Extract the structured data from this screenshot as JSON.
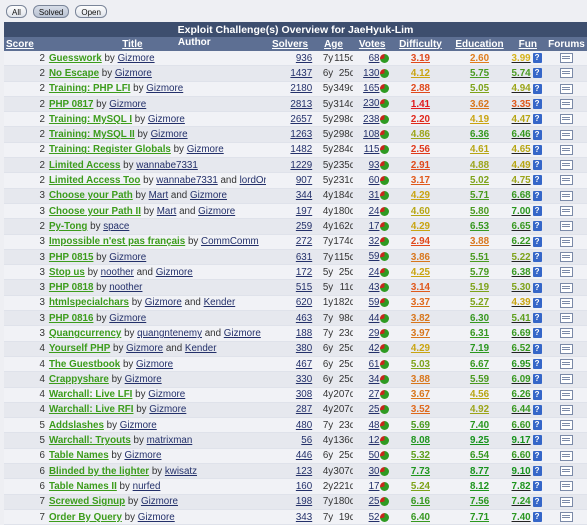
{
  "filters": [
    "All",
    "Solved",
    "Open"
  ],
  "active_filter": "Solved",
  "table_title": "Exploit Challenge(s) Overview for JaeHyuk-Lim",
  "headers": {
    "score": "Score",
    "title": "Title",
    "author": "Author",
    "solvers": "Solvers",
    "age": "Age",
    "votes": "Votes",
    "difficulty": "Difficulty",
    "education": "Education",
    "fun": "Fun",
    "forums": "Forums"
  },
  "rows": [
    {
      "score": "2",
      "title": "Guesswork",
      "authors": [
        "Gizmore"
      ],
      "solvers": "936",
      "age1": "7y",
      "age2": "115d",
      "votes": "68",
      "difficulty": "3.19",
      "education": "2.60",
      "fun": "3.99",
      "dc": "#e0491c",
      "ec": "#e07d1c",
      "fc": "#d6b31a"
    },
    {
      "score": "2",
      "title": "No Escape",
      "authors": [
        "Gizmore"
      ],
      "solvers": "1437",
      "age1": "6y",
      "age2": "25d",
      "votes": "130",
      "difficulty": "4.12",
      "education": "5.75",
      "fun": "5.74",
      "dc": "#c9a411",
      "ec": "#4a9a20",
      "fc": "#4a9a20"
    },
    {
      "score": "2",
      "title": "Training: PHP LFI",
      "authors": [
        "Gizmore"
      ],
      "solvers": "2180",
      "age1": "5y",
      "age2": "349d",
      "votes": "165",
      "difficulty": "2.88",
      "education": "5.05",
      "fun": "4.94",
      "dc": "#e0491c",
      "ec": "#7ea31a",
      "fc": "#9ca51a"
    },
    {
      "score": "2",
      "title": "PHP 0817",
      "authors": [
        "Gizmore"
      ],
      "solvers": "2813",
      "age1": "5y",
      "age2": "314d",
      "votes": "230",
      "difficulty": "1.41",
      "education": "3.62",
      "fun": "3.35",
      "dc": "#e0181c",
      "ec": "#d8761c",
      "fc": "#df591c"
    },
    {
      "score": "2",
      "title": "Training: MySQL I",
      "authors": [
        "Gizmore"
      ],
      "solvers": "2657",
      "age1": "5y",
      "age2": "298d",
      "votes": "238",
      "difficulty": "2.20",
      "education": "4.19",
      "fun": "4.47",
      "dc": "#e0281c",
      "ec": "#c9a411",
      "fc": "#b7a614"
    },
    {
      "score": "2",
      "title": "Training: MySQL II",
      "authors": [
        "Gizmore"
      ],
      "solvers": "1263",
      "age1": "5y",
      "age2": "298d",
      "votes": "108",
      "difficulty": "4.86",
      "education": "6.36",
      "fun": "6.46",
      "dc": "#9ca51a",
      "ec": "#379820",
      "fc": "#379820"
    },
    {
      "score": "2",
      "title": "Training: Register Globals",
      "authors": [
        "Gizmore"
      ],
      "solvers": "1482",
      "age1": "5y",
      "age2": "284d",
      "votes": "115",
      "difficulty": "2.56",
      "education": "4.61",
      "fun": "4.65",
      "dc": "#e0391c",
      "ec": "#b7a614",
      "fc": "#b7a614"
    },
    {
      "score": "2",
      "title": "Limited Access",
      "authors": [
        "wannabe7331"
      ],
      "solvers": "1229",
      "age1": "5y",
      "age2": "235d",
      "votes": "93",
      "difficulty": "2.91",
      "education": "4.88",
      "fun": "4.49",
      "dc": "#e0491c",
      "ec": "#9ca51a",
      "fc": "#b7a614"
    },
    {
      "score": "2",
      "title": "Limited Access Too",
      "authors": [
        "wannabe7331",
        "lordOric"
      ],
      "solvers": "907",
      "age1": "5y",
      "age2": "231d",
      "votes": "60",
      "difficulty": "3.17",
      "education": "5.02",
      "fun": "4.75",
      "dc": "#e0591c",
      "ec": "#7ea31a",
      "fc": "#9ca51a"
    },
    {
      "score": "3",
      "title": "Choose your Path",
      "authors": [
        "Mart",
        "Gizmore"
      ],
      "solvers": "344",
      "age1": "4y",
      "age2": "184d",
      "votes": "31",
      "difficulty": "4.29",
      "education": "5.71",
      "fun": "6.68",
      "dc": "#c9a411",
      "ec": "#4a9a20",
      "fc": "#379820"
    },
    {
      "score": "3",
      "title": "Choose your Path II",
      "authors": [
        "Mart",
        "Gizmore"
      ],
      "solvers": "197",
      "age1": "4y",
      "age2": "180d",
      "votes": "24",
      "difficulty": "4.60",
      "education": "5.80",
      "fun": "7.00",
      "dc": "#b7a614",
      "ec": "#4a9a20",
      "fc": "#2a971f"
    },
    {
      "score": "2",
      "title": "Py-Tong",
      "authors": [
        "space"
      ],
      "solvers": "259",
      "age1": "4y",
      "age2": "162d",
      "votes": "17",
      "difficulty": "4.29",
      "education": "6.53",
      "fun": "6.65",
      "dc": "#c9a411",
      "ec": "#379820",
      "fc": "#379820"
    },
    {
      "score": "3",
      "title": "Impossible n'est pas français",
      "authors": [
        "CommComm"
      ],
      "solvers": "272",
      "age1": "7y",
      "age2": "174d",
      "votes": "32",
      "difficulty": "2.94",
      "education": "3.88",
      "fun": "6.22",
      "dc": "#e0491c",
      "ec": "#d8761c",
      "fc": "#379820"
    },
    {
      "score": "3",
      "title": "PHP 0815",
      "authors": [
        "Gizmore"
      ],
      "solvers": "631",
      "age1": "7y",
      "age2": "115d",
      "votes": "59",
      "difficulty": "3.86",
      "education": "5.51",
      "fun": "5.22",
      "dc": "#d8761c",
      "ec": "#4a9a20",
      "fc": "#7ea31a"
    },
    {
      "score": "3",
      "title": "Stop us",
      "authors": [
        "noother",
        "Gizmore"
      ],
      "solvers": "172",
      "age1": "5y",
      "age2": "25d",
      "votes": "24",
      "difficulty": "4.25",
      "education": "5.79",
      "fun": "6.38",
      "dc": "#c9a411",
      "ec": "#4a9a20",
      "fc": "#379820"
    },
    {
      "score": "3",
      "title": "PHP 0818",
      "authors": [
        "noother"
      ],
      "solvers": "515",
      "age1": "5y",
      "age2": "11d",
      "votes": "43",
      "difficulty": "3.14",
      "education": "5.19",
      "fun": "5.30",
      "dc": "#e0591c",
      "ec": "#7ea31a",
      "fc": "#7ea31a"
    },
    {
      "score": "3",
      "title": "htmlspecialchars",
      "authors": [
        "Gizmore",
        "Kender"
      ],
      "solvers": "620",
      "age1": "1y",
      "age2": "182d",
      "votes": "59",
      "difficulty": "3.37",
      "education": "5.27",
      "fun": "4.39",
      "dc": "#df691c",
      "ec": "#7ea31a",
      "fc": "#c9a411"
    },
    {
      "score": "3",
      "title": "PHP 0816",
      "authors": [
        "Gizmore"
      ],
      "solvers": "463",
      "age1": "7y",
      "age2": "98d",
      "votes": "44",
      "difficulty": "3.82",
      "education": "6.30",
      "fun": "5.41",
      "dc": "#d8761c",
      "ec": "#379820",
      "fc": "#5d9f1d"
    },
    {
      "score": "3",
      "title": "Quangcurrency",
      "authors": [
        "quangntenemy",
        "Gizmore"
      ],
      "solvers": "188",
      "age1": "7y",
      "age2": "23d",
      "votes": "29",
      "difficulty": "3.97",
      "education": "6.31",
      "fun": "6.69",
      "dc": "#d8761c",
      "ec": "#379820",
      "fc": "#379820"
    },
    {
      "score": "4",
      "title": "Yourself PHP",
      "authors": [
        "Gizmore",
        "Kender"
      ],
      "solvers": "380",
      "age1": "6y",
      "age2": "25d",
      "votes": "42",
      "difficulty": "4.29",
      "education": "7.19",
      "fun": "6.52",
      "dc": "#c9a411",
      "ec": "#2a971f",
      "fc": "#379820"
    },
    {
      "score": "4",
      "title": "The Guestbook",
      "authors": [
        "Gizmore"
      ],
      "solvers": "467",
      "age1": "6y",
      "age2": "25d",
      "votes": "61",
      "difficulty": "5.03",
      "education": "6.67",
      "fun": "6.95",
      "dc": "#7ea31a",
      "ec": "#379820",
      "fc": "#2a971f"
    },
    {
      "score": "4",
      "title": "Crappyshare",
      "authors": [
        "Gizmore"
      ],
      "solvers": "330",
      "age1": "6y",
      "age2": "25d",
      "votes": "34",
      "difficulty": "3.88",
      "education": "5.59",
      "fun": "6.09",
      "dc": "#d8761c",
      "ec": "#4a9a20",
      "fc": "#379820"
    },
    {
      "score": "4",
      "title": "Warchall: Live LFI",
      "authors": [
        "Gizmore"
      ],
      "solvers": "308",
      "age1": "4y",
      "age2": "207d",
      "votes": "27",
      "difficulty": "3.67",
      "education": "4.56",
      "fun": "6.26",
      "dc": "#d8761c",
      "ec": "#b7a614",
      "fc": "#379820"
    },
    {
      "score": "4",
      "title": "Warchall: Live RFI",
      "authors": [
        "Gizmore"
      ],
      "solvers": "287",
      "age1": "4y",
      "age2": "207d",
      "votes": "25",
      "difficulty": "3.52",
      "education": "4.92",
      "fun": "6.44",
      "dc": "#df691c",
      "ec": "#9ca51a",
      "fc": "#379820"
    },
    {
      "score": "5",
      "title": "Addslashes",
      "authors": [
        "Gizmore"
      ],
      "solvers": "480",
      "age1": "7y",
      "age2": "23d",
      "votes": "48",
      "difficulty": "5.69",
      "education": "7.40",
      "fun": "6.60",
      "dc": "#4a9a20",
      "ec": "#2a971f",
      "fc": "#379820"
    },
    {
      "score": "5",
      "title": "Warchall: Tryouts",
      "authors": [
        "matrixman"
      ],
      "solvers": "56",
      "age1": "4y",
      "age2": "136d",
      "votes": "12",
      "difficulty": "8.08",
      "education": "9.25",
      "fun": "9.17",
      "dc": "#1e951e",
      "ec": "#16931c",
      "fc": "#16931c"
    },
    {
      "score": "6",
      "title": "Table Names",
      "authors": [
        "Gizmore"
      ],
      "solvers": "446",
      "age1": "6y",
      "age2": "25d",
      "votes": "50",
      "difficulty": "5.32",
      "education": "6.54",
      "fun": "6.60",
      "dc": "#5d9f1d",
      "ec": "#379820",
      "fc": "#379820"
    },
    {
      "score": "6",
      "title": "Blinded by the lighter",
      "authors": [
        "kwisatz"
      ],
      "solvers": "123",
      "age1": "4y",
      "age2": "307d",
      "votes": "30",
      "difficulty": "7.73",
      "education": "8.77",
      "fun": "9.10",
      "dc": "#1e951e",
      "ec": "#16931c",
      "fc": "#16931c"
    },
    {
      "score": "6",
      "title": "Table Names II",
      "authors": [
        "nurfed"
      ],
      "solvers": "160",
      "age1": "2y",
      "age2": "221d",
      "votes": "17",
      "difficulty": "5.24",
      "education": "8.12",
      "fun": "7.82",
      "dc": "#7ea31a",
      "ec": "#1e951e",
      "fc": "#1e951e"
    },
    {
      "score": "7",
      "title": "Screwed Signup",
      "authors": [
        "Gizmore"
      ],
      "solvers": "198",
      "age1": "7y",
      "age2": "180d",
      "votes": "25",
      "difficulty": "6.16",
      "education": "7.56",
      "fun": "7.24",
      "dc": "#379820",
      "ec": "#2a971f",
      "fc": "#2a971f"
    },
    {
      "score": "7",
      "title": "Order By Query",
      "authors": [
        "Gizmore"
      ],
      "solvers": "343",
      "age1": "7y",
      "age2": "19d",
      "votes": "52",
      "difficulty": "6.40",
      "education": "7.71",
      "fun": "7.40",
      "dc": "#379820",
      "ec": "#2a971f",
      "fc": "#2a971f"
    }
  ],
  "by_word": "by",
  "and_word": "and",
  "help_glyph": "?"
}
